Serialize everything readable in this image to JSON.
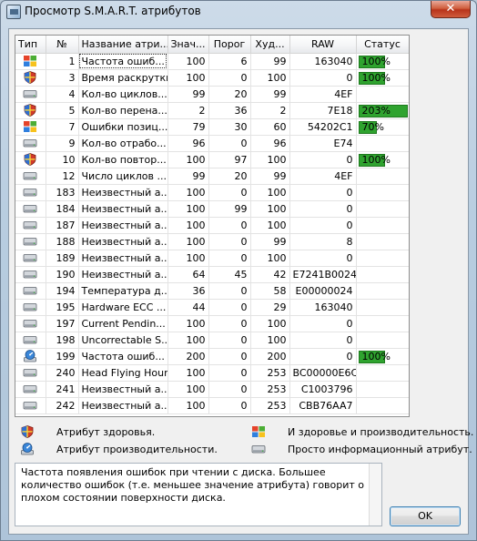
{
  "window": {
    "title": "Просмотр S.M.A.R.T. атрибутов",
    "close_glyph": "✕"
  },
  "table": {
    "headers": [
      "Тип",
      "№",
      "Название атри...",
      "Знач...",
      "Порог",
      "Худ...",
      "RAW",
      "Статус"
    ],
    "rows": [
      {
        "type": "health-perf",
        "id": "1",
        "name": "Частота ошиб...",
        "value": "100",
        "threshold": "6",
        "worst": "99",
        "raw": "163040",
        "status": "100%",
        "status_level": 0.53,
        "selected": true
      },
      {
        "type": "health",
        "id": "3",
        "name": "Время раскрутки",
        "value": "100",
        "threshold": "0",
        "worst": "100",
        "raw": "0",
        "status": "100%",
        "status_level": 0.53
      },
      {
        "type": "info",
        "id": "4",
        "name": "Кол-во циклов...",
        "value": "99",
        "threshold": "20",
        "worst": "99",
        "raw": "4EF",
        "status": "",
        "status_level": 0
      },
      {
        "type": "health",
        "id": "5",
        "name": "Кол-во перена...",
        "value": "2",
        "threshold": "36",
        "worst": "2",
        "raw": "7E18",
        "status": "203%",
        "status_level": 1.0
      },
      {
        "type": "health-perf",
        "id": "7",
        "name": "Ошибки позиц...",
        "value": "79",
        "threshold": "30",
        "worst": "60",
        "raw": "54202C1",
        "status": "70%",
        "status_level": 0.37
      },
      {
        "type": "info",
        "id": "9",
        "name": "Кол-во отрабо...",
        "value": "96",
        "threshold": "0",
        "worst": "96",
        "raw": "E74",
        "status": "",
        "status_level": 0
      },
      {
        "type": "health",
        "id": "10",
        "name": "Кол-во повтор...",
        "value": "100",
        "threshold": "97",
        "worst": "100",
        "raw": "0",
        "status": "100%",
        "status_level": 0.53
      },
      {
        "type": "info",
        "id": "12",
        "name": "Число циклов ...",
        "value": "99",
        "threshold": "20",
        "worst": "99",
        "raw": "4EF",
        "status": "",
        "status_level": 0
      },
      {
        "type": "info",
        "id": "183",
        "name": "Неизвестный а...",
        "value": "100",
        "threshold": "0",
        "worst": "100",
        "raw": "0",
        "status": "",
        "status_level": 0
      },
      {
        "type": "info",
        "id": "184",
        "name": "Неизвестный а...",
        "value": "100",
        "threshold": "99",
        "worst": "100",
        "raw": "0",
        "status": "",
        "status_level": 0
      },
      {
        "type": "info",
        "id": "187",
        "name": "Неизвестный а...",
        "value": "100",
        "threshold": "0",
        "worst": "100",
        "raw": "0",
        "status": "",
        "status_level": 0
      },
      {
        "type": "info",
        "id": "188",
        "name": "Неизвестный а...",
        "value": "100",
        "threshold": "0",
        "worst": "99",
        "raw": "8",
        "status": "",
        "status_level": 0
      },
      {
        "type": "info",
        "id": "189",
        "name": "Неизвестный а...",
        "value": "100",
        "threshold": "0",
        "worst": "100",
        "raw": "0",
        "status": "",
        "status_level": 0
      },
      {
        "type": "info",
        "id": "190",
        "name": "Неизвестный а...",
        "value": "64",
        "threshold": "45",
        "worst": "42",
        "raw": "E7241B0024",
        "status": "",
        "status_level": 0
      },
      {
        "type": "info",
        "id": "194",
        "name": "Температура д...",
        "value": "36",
        "threshold": "0",
        "worst": "58",
        "raw": "E00000024",
        "status": "",
        "status_level": 0
      },
      {
        "type": "info",
        "id": "195",
        "name": "Hardware ECC ...",
        "value": "44",
        "threshold": "0",
        "worst": "29",
        "raw": "163040",
        "status": "",
        "status_level": 0
      },
      {
        "type": "info",
        "id": "197",
        "name": "Current Pendin...",
        "value": "100",
        "threshold": "0",
        "worst": "100",
        "raw": "0",
        "status": "",
        "status_level": 0
      },
      {
        "type": "info",
        "id": "198",
        "name": "Uncorrectable S...",
        "value": "100",
        "threshold": "0",
        "worst": "100",
        "raw": "0",
        "status": "",
        "status_level": 0
      },
      {
        "type": "perf",
        "id": "199",
        "name": "Частота ошиб...",
        "value": "200",
        "threshold": "0",
        "worst": "200",
        "raw": "0",
        "status": "100%",
        "status_level": 0.53
      },
      {
        "type": "info",
        "id": "240",
        "name": "Head Flying Hours",
        "value": "100",
        "threshold": "0",
        "worst": "253",
        "raw": "BC00000E6C",
        "status": "",
        "status_level": 0
      },
      {
        "type": "info",
        "id": "241",
        "name": "Неизвестный а...",
        "value": "100",
        "threshold": "0",
        "worst": "253",
        "raw": "C1003796",
        "status": "",
        "status_level": 0
      },
      {
        "type": "info",
        "id": "242",
        "name": "Неизвестный а...",
        "value": "100",
        "threshold": "0",
        "worst": "253",
        "raw": "CBB76AA7",
        "status": "",
        "status_level": 0
      }
    ]
  },
  "legend": {
    "health": "Атрибут здоровья.",
    "health_perf": "И здоровье и производительность.",
    "perf": "Атрибут производительности.",
    "info": "Просто информационный атрибут."
  },
  "description": "Частота появления ошибок при чтении с диска. Большее количество ошибок (т.е. меньшее значение атрибута) говорит о плохом состоянии поверхности диска.",
  "ok_label": "OK",
  "colors": {
    "status_bar": "#2fa32f",
    "accent": "#3c7fb1"
  },
  "icons": {
    "health": "shield-icon",
    "health-perf": "windows-flag-icon",
    "perf": "gauge-icon",
    "info": "hard-drive-icon"
  }
}
